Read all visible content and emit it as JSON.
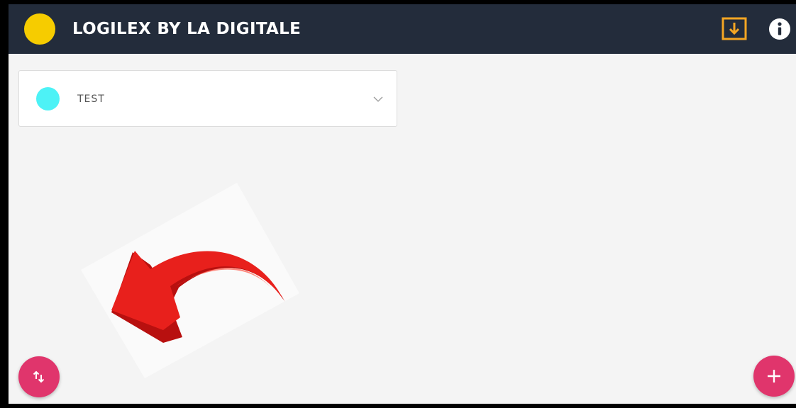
{
  "header": {
    "title": "LOGILEX BY LA DIGITALE",
    "logo_color": "#f6cc00",
    "background_color": "#232c3b",
    "download_icon": "download-box-icon",
    "download_icon_color": "#f5a623",
    "info_icon": "info-circle-icon"
  },
  "words": [
    {
      "label": "TEST",
      "color": "#4df2f6",
      "toggle_icon": "chevron-down-icon"
    }
  ],
  "overlay": {
    "image": "red-curved-arrow",
    "color": "#e8201c"
  },
  "fabs": {
    "sort_icon": "sort-arrows-icon",
    "add_icon": "plus-icon",
    "color": "#e0356c"
  }
}
